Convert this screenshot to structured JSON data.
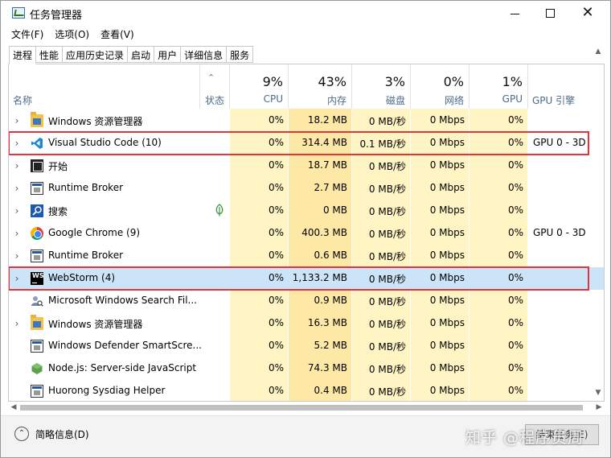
{
  "window": {
    "title": "任务管理器"
  },
  "menu": [
    "文件(F)",
    "选项(O)",
    "查看(V)"
  ],
  "tabs": [
    "进程",
    "性能",
    "应用历史记录",
    "启动",
    "用户",
    "详细信息",
    "服务"
  ],
  "active_tab": "进程",
  "columns": {
    "name": "名称",
    "status": "状态",
    "cpu": {
      "label": "CPU",
      "pct": "9%"
    },
    "memory": {
      "label": "内存",
      "pct": "43%"
    },
    "disk": {
      "label": "磁盘",
      "pct": "3%"
    },
    "network": {
      "label": "网络",
      "pct": "0%"
    },
    "gpu": {
      "label": "GPU",
      "pct": "1%"
    },
    "gpu_engine": {
      "label": "GPU 引擎"
    }
  },
  "rows": [
    {
      "name": "Windows 资源管理器",
      "icon": "folder-icon",
      "expand": true,
      "cpu": "0%",
      "memory": "18.2 MB",
      "disk": "0 MB/秒",
      "network": "0 Mbps",
      "gpu": "0%",
      "gpu_engine": ""
    },
    {
      "name": "Visual Studio Code (10)",
      "icon": "vscode-icon",
      "expand": true,
      "cpu": "0%",
      "memory": "314.4 MB",
      "disk": "0.1 MB/秒",
      "network": "0 Mbps",
      "gpu": "0%",
      "gpu_engine": "GPU 0 - 3D"
    },
    {
      "name": "开始",
      "icon": "start-icon",
      "expand": true,
      "cpu": "0%",
      "memory": "18.7 MB",
      "disk": "0 MB/秒",
      "network": "0 Mbps",
      "gpu": "0%",
      "gpu_engine": ""
    },
    {
      "name": "Runtime Broker",
      "icon": "app-window-icon",
      "expand": true,
      "cpu": "0%",
      "memory": "2.7 MB",
      "disk": "0 MB/秒",
      "network": "0 Mbps",
      "gpu": "0%",
      "gpu_engine": ""
    },
    {
      "name": "搜索",
      "icon": "search-icon",
      "expand": true,
      "cpu": "0%",
      "memory": "0 MB",
      "disk": "0 MB/秒",
      "network": "0 Mbps",
      "gpu": "0%",
      "gpu_engine": "",
      "status_icon": "leaf-icon"
    },
    {
      "name": "Google Chrome (9)",
      "icon": "chrome-icon",
      "expand": true,
      "cpu": "0%",
      "memory": "400.3 MB",
      "disk": "0 MB/秒",
      "network": "0 Mbps",
      "gpu": "0%",
      "gpu_engine": "GPU 0 - 3D"
    },
    {
      "name": "Runtime Broker",
      "icon": "app-window-icon",
      "expand": true,
      "cpu": "0%",
      "memory": "0.6 MB",
      "disk": "0 MB/秒",
      "network": "0 Mbps",
      "gpu": "0%",
      "gpu_engine": ""
    },
    {
      "name": "WebStorm (4)",
      "icon": "webstorm-icon",
      "expand": true,
      "cpu": "0%",
      "memory": "1,133.2 MB",
      "disk": "0 MB/秒",
      "network": "0 Mbps",
      "gpu": "0%",
      "gpu_engine": "",
      "selected": true
    },
    {
      "name": "Microsoft Windows Search Fil...",
      "icon": "user-search-icon",
      "expand": false,
      "cpu": "0%",
      "memory": "0.9 MB",
      "disk": "0 MB/秒",
      "network": "0 Mbps",
      "gpu": "0%",
      "gpu_engine": ""
    },
    {
      "name": "Windows 资源管理器",
      "icon": "folder-icon",
      "expand": true,
      "cpu": "0%",
      "memory": "16.3 MB",
      "disk": "0 MB/秒",
      "network": "0 Mbps",
      "gpu": "0%",
      "gpu_engine": ""
    },
    {
      "name": "Windows Defender SmartScre...",
      "icon": "app-window-icon",
      "expand": false,
      "cpu": "0%",
      "memory": "5.2 MB",
      "disk": "0 MB/秒",
      "network": "0 Mbps",
      "gpu": "0%",
      "gpu_engine": ""
    },
    {
      "name": "Node.js: Server-side JavaScript",
      "icon": "nodejs-icon",
      "expand": false,
      "cpu": "0%",
      "memory": "74.3 MB",
      "disk": "0 MB/秒",
      "network": "0 Mbps",
      "gpu": "0%",
      "gpu_engine": ""
    },
    {
      "name": "Huorong Sysdiag Helper",
      "icon": "app-window-icon",
      "expand": false,
      "cpu": "0%",
      "memory": "0.4 MB",
      "disk": "0 MB/秒",
      "network": "0 Mbps",
      "gpu": "0%",
      "gpu_engine": ""
    }
  ],
  "footer": {
    "fewer_details": "简略信息(D)",
    "end_task": "结束任务(E)",
    "watermark": "知乎 @程序员周"
  },
  "colors": {
    "cpu_col": "#fff4c4",
    "memory_col": "#fde8a6",
    "selected_row": "#cce4f7",
    "annotation_box": "#e0353b"
  }
}
